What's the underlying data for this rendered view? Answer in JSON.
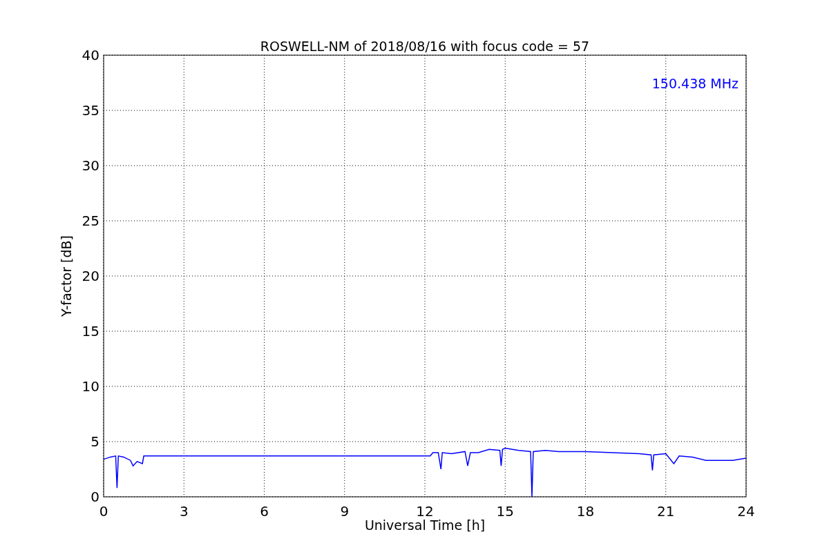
{
  "figure": {
    "chart_data": {
      "type": "line",
      "title": "ROSWELL-NM of 2018/08/16 with focus code = 57",
      "xlabel": "Universal Time [h]",
      "ylabel": "Y-factor [dB]",
      "x": [
        0,
        0.25,
        0.45,
        0.5,
        0.55,
        0.75,
        1,
        1.1,
        1.25,
        1.45,
        1.5,
        3,
        6,
        9,
        12.2,
        12.3,
        12.5,
        12.6,
        12.65,
        13,
        13.5,
        13.6,
        13.7,
        14,
        14.4,
        14.8,
        14.85,
        14.9,
        15,
        15.5,
        15.95,
        16.0,
        16.05,
        16.5,
        17,
        18,
        19,
        20,
        20.45,
        20.5,
        20.55,
        21,
        21.3,
        21.5,
        22,
        22.5,
        23,
        23.5,
        24
      ],
      "series": [
        {
          "name": "150.438 MHz",
          "color": "#0000ff",
          "values": [
            3.4,
            3.6,
            3.7,
            0.8,
            3.7,
            3.6,
            3.3,
            2.8,
            3.2,
            3.0,
            3.7,
            3.7,
            3.7,
            3.7,
            3.7,
            4.0,
            4.0,
            2.5,
            4.0,
            3.9,
            4.1,
            2.8,
            4.0,
            4.0,
            4.3,
            4.2,
            2.8,
            4.3,
            4.4,
            4.2,
            4.1,
            0,
            4.1,
            4.2,
            4.1,
            4.1,
            4.0,
            3.9,
            3.8,
            2.4,
            3.8,
            3.9,
            3.0,
            3.7,
            3.6,
            3.3,
            3.3,
            3.3,
            3.5
          ]
        }
      ],
      "xlim": [
        0,
        24
      ],
      "ylim": [
        0,
        40
      ],
      "xticks": [
        0,
        3,
        6,
        9,
        12,
        15,
        18,
        21,
        24
      ],
      "yticks": [
        0,
        5,
        10,
        15,
        20,
        25,
        30,
        35,
        40
      ],
      "grid": true
    }
  }
}
